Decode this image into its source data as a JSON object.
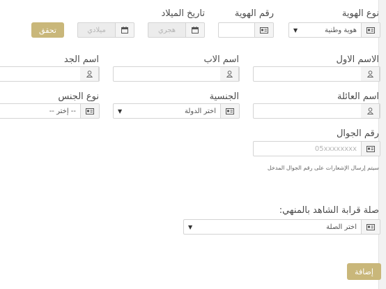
{
  "form": {
    "id_type": {
      "label": "نوع الهوية",
      "value": "هوية وطنية"
    },
    "id_number": {
      "label": "رقم الهوية",
      "value": ""
    },
    "birth_date": {
      "label": "تاريخ الميلاد",
      "hijri_placeholder": "هجري",
      "gregorian_placeholder": "ميلادي"
    },
    "verify_button": "تحقق",
    "first_name": {
      "label": "الاسم الاول"
    },
    "father_name": {
      "label": "اسم الاب"
    },
    "grandfather_name": {
      "label": "اسم الجد"
    },
    "family_name": {
      "label": "اسم العائلة"
    },
    "nationality": {
      "label": "الجنسية",
      "placeholder": "اختر الدولة"
    },
    "gender": {
      "label": "نوع الجنس",
      "placeholder": "-- إختر --"
    },
    "mobile": {
      "label": "رقم الجوال",
      "placeholder": "05xxxxxxxx",
      "hint": "سيتم إرسال الإشعارات على رقم الجوال المدخل"
    },
    "relation": {
      "label": "صلة قرابة الشاهد بالمنهي:",
      "placeholder": "اختر الصلة"
    },
    "add_button": "إضافة"
  },
  "colors": {
    "accent": "#c9b77a",
    "disabled_bg": "#ececec",
    "border": "#d4d4d4"
  },
  "icons": [
    "id-card-icon",
    "calendar-icon",
    "user-icon",
    "phone-icon",
    "dropdown-caret-icon"
  ]
}
